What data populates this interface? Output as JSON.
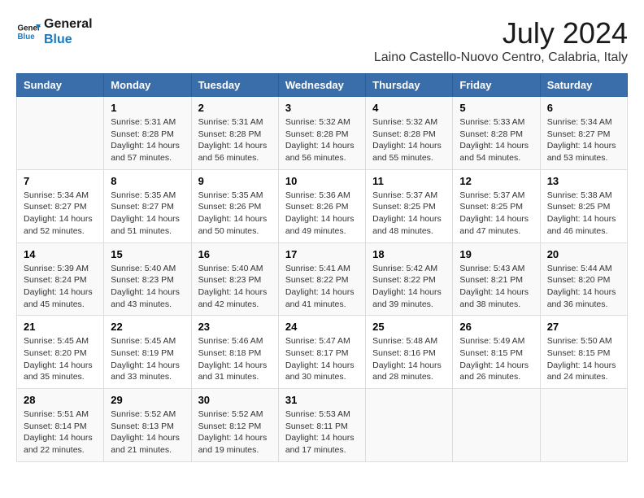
{
  "header": {
    "logo_line1": "General",
    "logo_line2": "Blue",
    "month": "July 2024",
    "location": "Laino Castello-Nuovo Centro, Calabria, Italy"
  },
  "weekdays": [
    "Sunday",
    "Monday",
    "Tuesday",
    "Wednesday",
    "Thursday",
    "Friday",
    "Saturday"
  ],
  "weeks": [
    [
      {
        "day": "",
        "info": ""
      },
      {
        "day": "1",
        "info": "Sunrise: 5:31 AM\nSunset: 8:28 PM\nDaylight: 14 hours\nand 57 minutes."
      },
      {
        "day": "2",
        "info": "Sunrise: 5:31 AM\nSunset: 8:28 PM\nDaylight: 14 hours\nand 56 minutes."
      },
      {
        "day": "3",
        "info": "Sunrise: 5:32 AM\nSunset: 8:28 PM\nDaylight: 14 hours\nand 56 minutes."
      },
      {
        "day": "4",
        "info": "Sunrise: 5:32 AM\nSunset: 8:28 PM\nDaylight: 14 hours\nand 55 minutes."
      },
      {
        "day": "5",
        "info": "Sunrise: 5:33 AM\nSunset: 8:28 PM\nDaylight: 14 hours\nand 54 minutes."
      },
      {
        "day": "6",
        "info": "Sunrise: 5:34 AM\nSunset: 8:27 PM\nDaylight: 14 hours\nand 53 minutes."
      }
    ],
    [
      {
        "day": "7",
        "info": "Sunrise: 5:34 AM\nSunset: 8:27 PM\nDaylight: 14 hours\nand 52 minutes."
      },
      {
        "day": "8",
        "info": "Sunrise: 5:35 AM\nSunset: 8:27 PM\nDaylight: 14 hours\nand 51 minutes."
      },
      {
        "day": "9",
        "info": "Sunrise: 5:35 AM\nSunset: 8:26 PM\nDaylight: 14 hours\nand 50 minutes."
      },
      {
        "day": "10",
        "info": "Sunrise: 5:36 AM\nSunset: 8:26 PM\nDaylight: 14 hours\nand 49 minutes."
      },
      {
        "day": "11",
        "info": "Sunrise: 5:37 AM\nSunset: 8:25 PM\nDaylight: 14 hours\nand 48 minutes."
      },
      {
        "day": "12",
        "info": "Sunrise: 5:37 AM\nSunset: 8:25 PM\nDaylight: 14 hours\nand 47 minutes."
      },
      {
        "day": "13",
        "info": "Sunrise: 5:38 AM\nSunset: 8:25 PM\nDaylight: 14 hours\nand 46 minutes."
      }
    ],
    [
      {
        "day": "14",
        "info": "Sunrise: 5:39 AM\nSunset: 8:24 PM\nDaylight: 14 hours\nand 45 minutes."
      },
      {
        "day": "15",
        "info": "Sunrise: 5:40 AM\nSunset: 8:23 PM\nDaylight: 14 hours\nand 43 minutes."
      },
      {
        "day": "16",
        "info": "Sunrise: 5:40 AM\nSunset: 8:23 PM\nDaylight: 14 hours\nand 42 minutes."
      },
      {
        "day": "17",
        "info": "Sunrise: 5:41 AM\nSunset: 8:22 PM\nDaylight: 14 hours\nand 41 minutes."
      },
      {
        "day": "18",
        "info": "Sunrise: 5:42 AM\nSunset: 8:22 PM\nDaylight: 14 hours\nand 39 minutes."
      },
      {
        "day": "19",
        "info": "Sunrise: 5:43 AM\nSunset: 8:21 PM\nDaylight: 14 hours\nand 38 minutes."
      },
      {
        "day": "20",
        "info": "Sunrise: 5:44 AM\nSunset: 8:20 PM\nDaylight: 14 hours\nand 36 minutes."
      }
    ],
    [
      {
        "day": "21",
        "info": "Sunrise: 5:45 AM\nSunset: 8:20 PM\nDaylight: 14 hours\nand 35 minutes."
      },
      {
        "day": "22",
        "info": "Sunrise: 5:45 AM\nSunset: 8:19 PM\nDaylight: 14 hours\nand 33 minutes."
      },
      {
        "day": "23",
        "info": "Sunrise: 5:46 AM\nSunset: 8:18 PM\nDaylight: 14 hours\nand 31 minutes."
      },
      {
        "day": "24",
        "info": "Sunrise: 5:47 AM\nSunset: 8:17 PM\nDaylight: 14 hours\nand 30 minutes."
      },
      {
        "day": "25",
        "info": "Sunrise: 5:48 AM\nSunset: 8:16 PM\nDaylight: 14 hours\nand 28 minutes."
      },
      {
        "day": "26",
        "info": "Sunrise: 5:49 AM\nSunset: 8:15 PM\nDaylight: 14 hours\nand 26 minutes."
      },
      {
        "day": "27",
        "info": "Sunrise: 5:50 AM\nSunset: 8:15 PM\nDaylight: 14 hours\nand 24 minutes."
      }
    ],
    [
      {
        "day": "28",
        "info": "Sunrise: 5:51 AM\nSunset: 8:14 PM\nDaylight: 14 hours\nand 22 minutes."
      },
      {
        "day": "29",
        "info": "Sunrise: 5:52 AM\nSunset: 8:13 PM\nDaylight: 14 hours\nand 21 minutes."
      },
      {
        "day": "30",
        "info": "Sunrise: 5:52 AM\nSunset: 8:12 PM\nDaylight: 14 hours\nand 19 minutes."
      },
      {
        "day": "31",
        "info": "Sunrise: 5:53 AM\nSunset: 8:11 PM\nDaylight: 14 hours\nand 17 minutes."
      },
      {
        "day": "",
        "info": ""
      },
      {
        "day": "",
        "info": ""
      },
      {
        "day": "",
        "info": ""
      }
    ]
  ]
}
